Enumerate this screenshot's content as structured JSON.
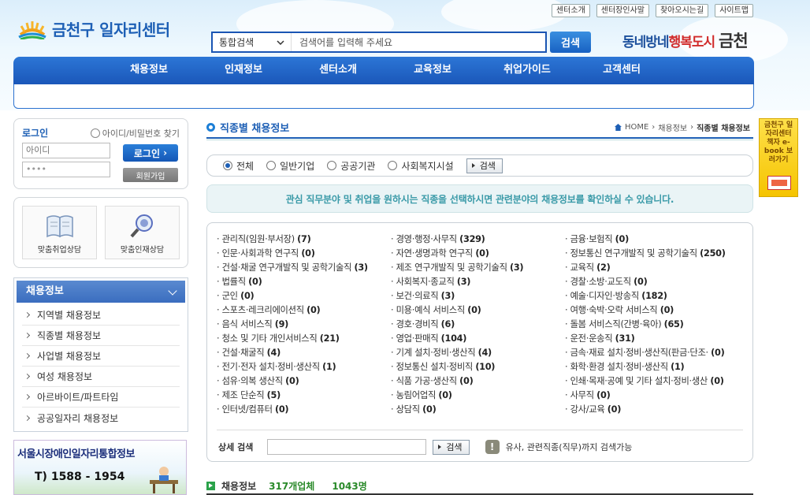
{
  "site": {
    "logo_text": "금천구 일자리센터"
  },
  "util_links": [
    "센터소개",
    "센터장인사말",
    "찾아오시는길",
    "사이트맵"
  ],
  "search": {
    "category": "통합검색",
    "placeholder": "검색어를 입력해 주세요",
    "button": "검색"
  },
  "slogan": {
    "part1": "동네방네",
    "part2": "행복도시",
    "part3": "금천"
  },
  "gnb": [
    "채용정보",
    "인재정보",
    "센터소개",
    "교육정보",
    "취업가이드",
    "고객센터"
  ],
  "login": {
    "title": "로그인",
    "find": "아이디/비밀번호 찾기",
    "id_placeholder": "아이디",
    "pw_value": "••••",
    "login_button": "로그인",
    "join_button": "회원가입"
  },
  "consult": {
    "job_seek": "맞춤취업상담",
    "talent": "맞춤인재상담"
  },
  "side_menu": {
    "title": "채용정보",
    "items": [
      "지역별 채용정보",
      "직종별 채용정보",
      "사업별 채용정보",
      "여성 채용정보",
      "아르바이트/파트타임",
      "공공일자리 채용정보"
    ]
  },
  "banner": {
    "title": "서울시장애인일자리통합정보",
    "tel": "T) 1588 - 1954"
  },
  "page": {
    "title": "직종별 채용정보",
    "crumb_home": "HOME",
    "crumb_1": "채용정보",
    "crumb_2": "직종별 채용정보"
  },
  "filter": {
    "options": [
      "전체",
      "일반기업",
      "공공기관",
      "사회복지시설"
    ],
    "selected": "전체",
    "button": "검색"
  },
  "info_message": "관심 직무분야 및 취업을 원하시는 직종을 선택하시면 관련분야의 채용정보를 확인하실 수 있습니다.",
  "jobs": [
    {
      "name": "관리직(임원·부서장)",
      "count": "(7)"
    },
    {
      "name": "경영·행정·사무직",
      "count": "(329)"
    },
    {
      "name": "금융·보험직",
      "count": "(0)"
    },
    {
      "name": "인문·사회과학 연구직",
      "count": "(0)"
    },
    {
      "name": "자연·생명과학 연구직",
      "count": "(0)"
    },
    {
      "name": "정보통신 연구개발직 및 공학기술직",
      "count": "(250)"
    },
    {
      "name": "건설·채굴 연구개발직 및 공학기술직",
      "count": "(3)"
    },
    {
      "name": "제조 연구개발직 및 공학기술직",
      "count": "(3)"
    },
    {
      "name": "교육직",
      "count": "(2)"
    },
    {
      "name": "법률직",
      "count": "(0)"
    },
    {
      "name": "사회복지·종교직",
      "count": "(3)"
    },
    {
      "name": "경찰·소방·교도직",
      "count": "(0)"
    },
    {
      "name": "군인",
      "count": "(0)"
    },
    {
      "name": "보건·의료직",
      "count": "(3)"
    },
    {
      "name": "예술·디자인·방송직",
      "count": "(182)"
    },
    {
      "name": "스포츠·레크리에이션직",
      "count": "(0)"
    },
    {
      "name": "미용·예식 서비스직",
      "count": "(0)"
    },
    {
      "name": "여행·숙박·오락 서비스직",
      "count": "(0)"
    },
    {
      "name": "음식 서비스직",
      "count": "(9)"
    },
    {
      "name": "경호·경비직",
      "count": "(6)"
    },
    {
      "name": "돌봄 서비스직(간병·육아)",
      "count": "(65)"
    },
    {
      "name": "청소 및 기타 개인서비스직",
      "count": "(21)"
    },
    {
      "name": "영업·판매직",
      "count": "(104)"
    },
    {
      "name": "운전·운송직",
      "count": "(31)"
    },
    {
      "name": "건설·채굴직",
      "count": "(4)"
    },
    {
      "name": "기계 설치·정비·생산직",
      "count": "(4)"
    },
    {
      "name": "금속·재료 설치·정비·생산직(판금·단조·",
      "count": "(0)"
    },
    {
      "name": "전기·전자 설치·정비·생산직",
      "count": "(1)"
    },
    {
      "name": "정보통신 설치·정비직",
      "count": "(10)"
    },
    {
      "name": "화학·환경 설치·정비·생산직",
      "count": "(1)"
    },
    {
      "name": "섬유·의복 생산직",
      "count": "(0)"
    },
    {
      "name": "식품 가공·생산직",
      "count": "(0)"
    },
    {
      "name": "인쇄·목재·공예 및 기타 설치·정비·생산",
      "count": "(0)"
    },
    {
      "name": "제조 단순직",
      "count": "(5)"
    },
    {
      "name": "농림어업직",
      "count": "(0)"
    },
    {
      "name": "사무직",
      "count": "(0)"
    },
    {
      "name": "인터넷/컴퓨터",
      "count": "(0)"
    },
    {
      "name": "상담직",
      "count": "(0)"
    },
    {
      "name": "강사/교육",
      "count": "(0)"
    }
  ],
  "detail_search": {
    "label": "상세 검색",
    "button": "검색",
    "hint": "유사, 관련직종(직무)까지 검색가능"
  },
  "result": {
    "label": "채용정보",
    "companies": "317개업체",
    "postings": "1043명"
  },
  "ebook": {
    "text": "금천구 일자리센터 책자 e-book 보러가기"
  },
  "colors": {
    "primary": "#1d5fb5",
    "gnb": "#2c76d6",
    "info_text": "#3a9aa8",
    "result_num": "#2a8a2a"
  }
}
